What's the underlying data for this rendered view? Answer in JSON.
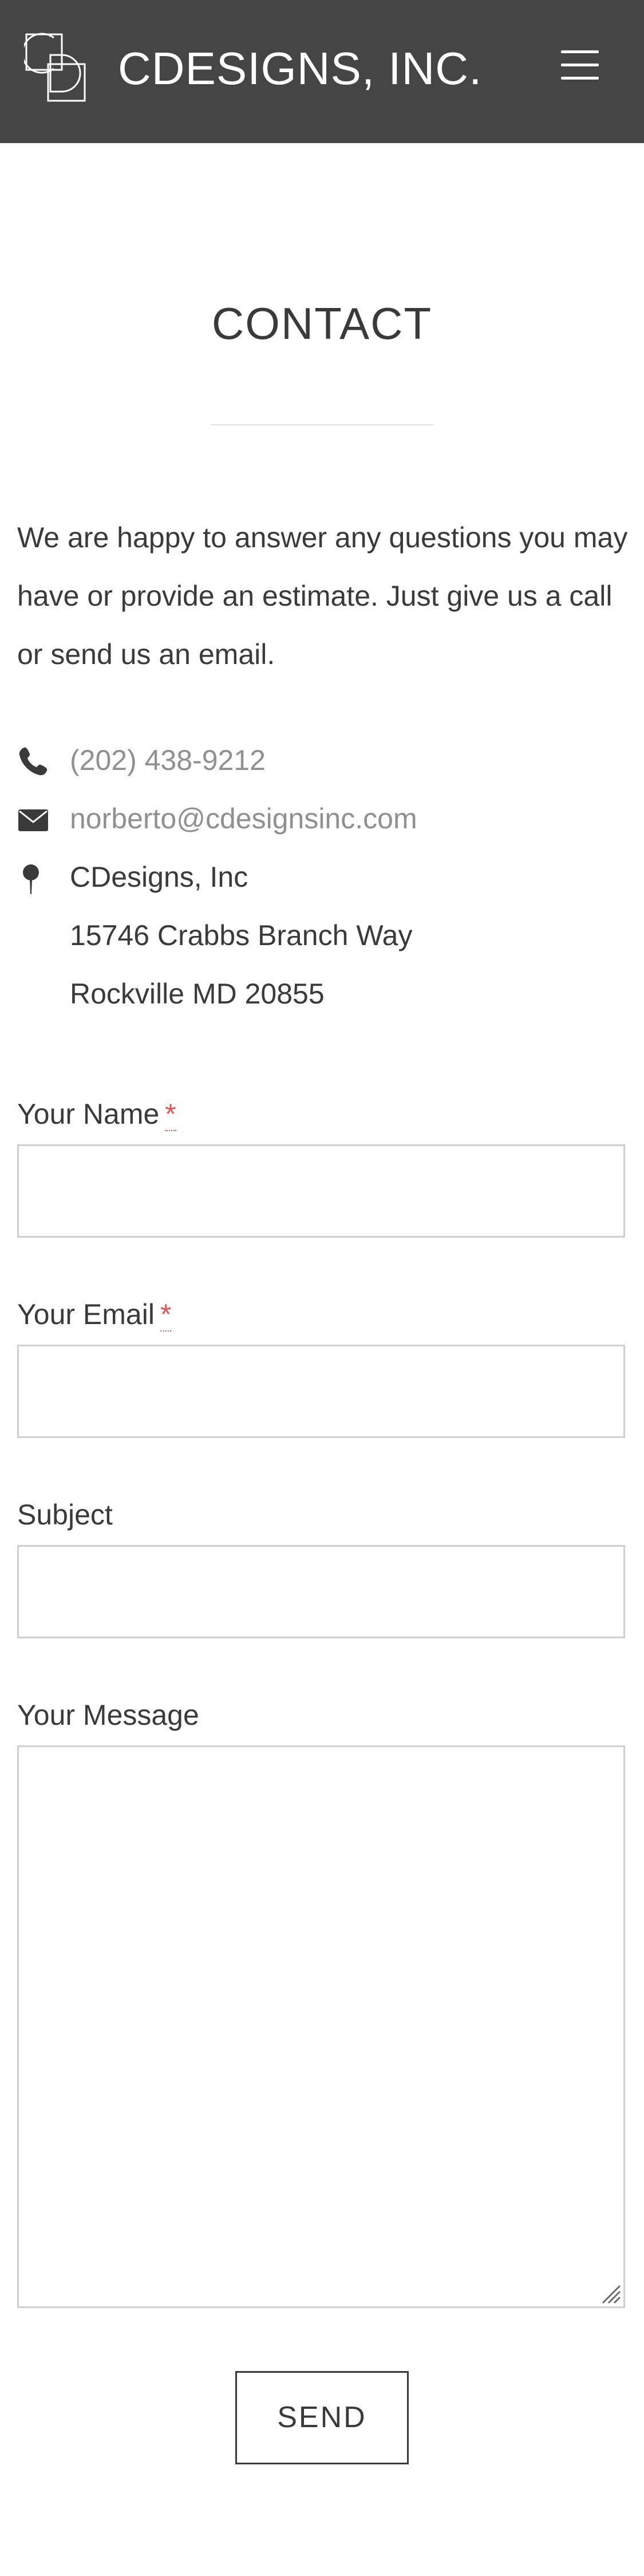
{
  "header": {
    "brand": "CDESIGNS, INC.",
    "logo_icon": "cd-monogram-logo",
    "menu_icon": "hamburger-menu-icon",
    "background": "#454545"
  },
  "main": {
    "title": "CONTACT",
    "intro": "We are happy to answer any questions you may have or provide an estimate. Just give us a call or send us an email."
  },
  "contact": {
    "phone": "(202) 438-9212",
    "email": "norberto@cdesignsinc.com",
    "address_lines": [
      "CDesigns, Inc",
      "15746 Crabbs Branch Way",
      "Rockville MD 20855"
    ],
    "icons": [
      "phone-icon",
      "envelope-icon",
      "map-pin-icon"
    ],
    "link_color": "#909090"
  },
  "form": {
    "name_label": "Your Name",
    "email_label": "Your Email",
    "subject_label": "Subject",
    "message_label": "Your Message",
    "required_mark": "*",
    "name_value": "",
    "email_value": "",
    "subject_value": "",
    "message_value": "",
    "send_label": "SEND",
    "required_color": "#e25555"
  }
}
